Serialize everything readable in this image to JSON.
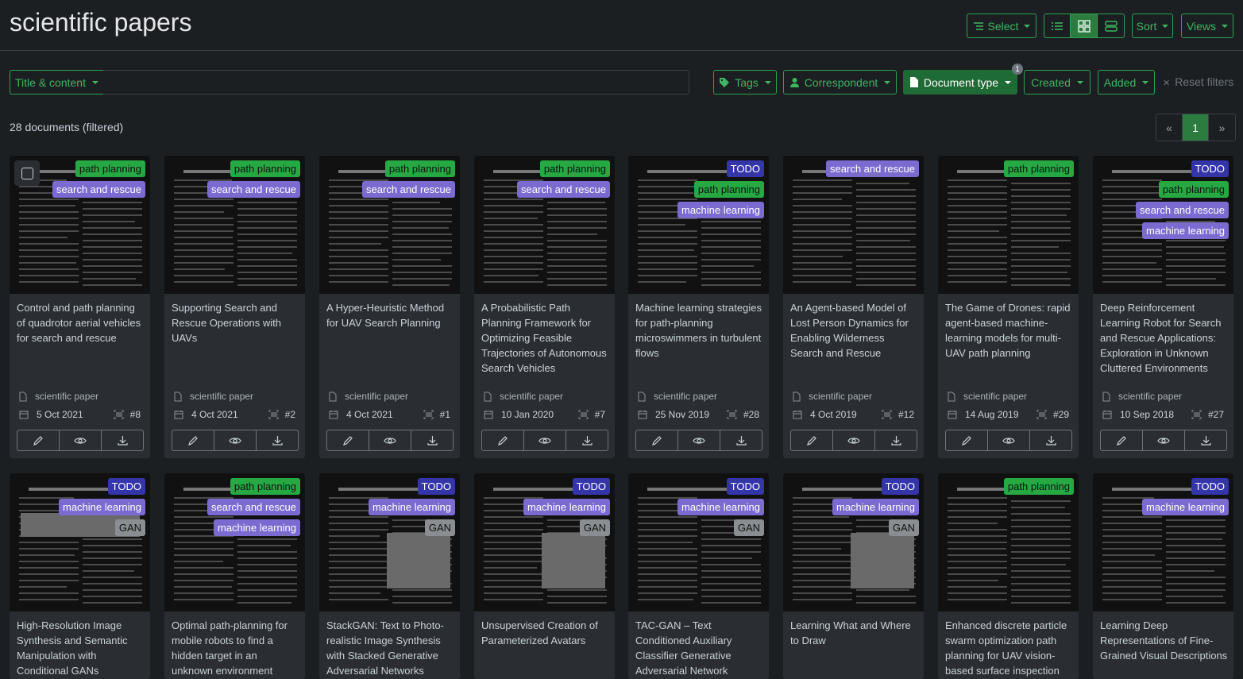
{
  "header": {
    "title": "scientific papers",
    "select_label": "Select",
    "sort_label": "Sort",
    "views_label": "Views"
  },
  "filters": {
    "title_content": "Title & content",
    "search_value": "",
    "tags": "Tags",
    "correspondent": "Correspondent",
    "document_type": "Document type",
    "document_type_count": "1",
    "created": "Created",
    "added": "Added",
    "reset": "Reset filters"
  },
  "summary": {
    "count_text": "28 documents (filtered)"
  },
  "pagination": {
    "prev": "«",
    "current": "1",
    "next": "»"
  },
  "colors": {
    "accent": "#2ea04f",
    "tag_path_planning": "#26a943",
    "tag_search_rescue": "#7b6bd1",
    "tag_todo": "#3435a8",
    "tag_gan": "#8a8e92"
  },
  "cards": [
    {
      "title": "Control and path planning of quadrotor aerial vehicles for search and rescue",
      "type": "scientific paper",
      "date": "5 Oct 2021",
      "num": "#8",
      "tags": [
        {
          "label": "path planning",
          "color": "green"
        },
        {
          "label": "search and rescue",
          "color": "purple"
        }
      ]
    },
    {
      "title": "Supporting Search and Rescue Operations with UAVs",
      "type": "scientific paper",
      "date": "4 Oct 2021",
      "num": "#2",
      "tags": [
        {
          "label": "path planning",
          "color": "green"
        },
        {
          "label": "search and rescue",
          "color": "purple"
        }
      ]
    },
    {
      "title": "A Hyper-Heuristic Method for UAV Search Planning",
      "type": "scientific paper",
      "date": "4 Oct 2021",
      "num": "#1",
      "tags": [
        {
          "label": "path planning",
          "color": "green"
        },
        {
          "label": "search and rescue",
          "color": "purple"
        }
      ]
    },
    {
      "title": "A Probabilistic Path Planning Framework for Optimizing Feasible Trajectories of Autonomous Search Vehicles",
      "type": "scientific paper",
      "date": "10 Jan 2020",
      "num": "#7",
      "tags": [
        {
          "label": "path planning",
          "color": "green"
        },
        {
          "label": "search and rescue",
          "color": "purple"
        }
      ]
    },
    {
      "title": "Machine learning strategies for path-planning microswimmers in turbulent flows",
      "type": "scientific paper",
      "date": "25 Nov 2019",
      "num": "#28",
      "tags": [
        {
          "label": "TODO",
          "color": "navy"
        },
        {
          "label": "path planning",
          "color": "green"
        },
        {
          "label": "machine learning",
          "color": "purple"
        }
      ]
    },
    {
      "title": "An Agent-based Model of Lost Person Dynamics for Enabling Wilderness Search and Rescue",
      "type": "scientific paper",
      "date": "4 Oct 2019",
      "num": "#12",
      "tags": [
        {
          "label": "search and rescue",
          "color": "purple"
        }
      ]
    },
    {
      "title": "The Game of Drones: rapid agent-based machine-learning models for multi-UAV path planning",
      "type": "scientific paper",
      "date": "14 Aug 2019",
      "num": "#29",
      "tags": [
        {
          "label": "path planning",
          "color": "green"
        }
      ]
    },
    {
      "title": "Deep Reinforcement Learning Robot for Search and Rescue Applications: Exploration in Unknown Cluttered Environments",
      "type": "scientific paper",
      "date": "10 Sep 2018",
      "num": "#27",
      "tags": [
        {
          "label": "TODO",
          "color": "navy"
        },
        {
          "label": "path planning",
          "color": "green"
        },
        {
          "label": "search and rescue",
          "color": "purple"
        },
        {
          "label": "machine learning",
          "color": "purple"
        }
      ]
    },
    {
      "title": "High-Resolution Image Synthesis and Semantic Manipulation with Conditional GANs",
      "type": "",
      "date": "",
      "num": "",
      "tags": [
        {
          "label": "TODO",
          "color": "navy"
        },
        {
          "label": "machine learning",
          "color": "purple"
        },
        {
          "label": "GAN",
          "color": "gray"
        }
      ]
    },
    {
      "title": "Optimal path-planning for mobile robots to find a hidden target in an unknown environment based on",
      "type": "",
      "date": "",
      "num": "",
      "tags": [
        {
          "label": "path planning",
          "color": "green"
        },
        {
          "label": "search and rescue",
          "color": "purple"
        },
        {
          "label": "machine learning",
          "color": "purple"
        }
      ]
    },
    {
      "title": "StackGAN: Text to Photo-realistic Image Synthesis with Stacked Generative Adversarial Networks",
      "type": "",
      "date": "",
      "num": "",
      "tags": [
        {
          "label": "TODO",
          "color": "navy"
        },
        {
          "label": "machine learning",
          "color": "purple"
        },
        {
          "label": "GAN",
          "color": "gray"
        }
      ]
    },
    {
      "title": "Unsupervised Creation of Parameterized Avatars",
      "type": "",
      "date": "",
      "num": "",
      "tags": [
        {
          "label": "TODO",
          "color": "navy"
        },
        {
          "label": "machine learning",
          "color": "purple"
        },
        {
          "label": "GAN",
          "color": "gray"
        }
      ]
    },
    {
      "title": "TAC-GAN – Text Conditioned Auxiliary Classifier Generative Adversarial Network",
      "type": "",
      "date": "",
      "num": "",
      "tags": [
        {
          "label": "TODO",
          "color": "navy"
        },
        {
          "label": "machine learning",
          "color": "purple"
        },
        {
          "label": "GAN",
          "color": "gray"
        }
      ]
    },
    {
      "title": "Learning What and Where to Draw",
      "type": "",
      "date": "",
      "num": "",
      "tags": [
        {
          "label": "TODO",
          "color": "navy"
        },
        {
          "label": "machine learning",
          "color": "purple"
        },
        {
          "label": "GAN",
          "color": "gray"
        }
      ]
    },
    {
      "title": "Enhanced discrete particle swarm optimization path planning for UAV vision-based surface inspection",
      "type": "",
      "date": "",
      "num": "",
      "tags": [
        {
          "label": "path planning",
          "color": "green"
        }
      ]
    },
    {
      "title": "Learning Deep Representations of Fine-Grained Visual Descriptions",
      "type": "",
      "date": "",
      "num": "",
      "tags": [
        {
          "label": "TODO",
          "color": "navy"
        },
        {
          "label": "machine learning",
          "color": "purple"
        }
      ]
    }
  ]
}
